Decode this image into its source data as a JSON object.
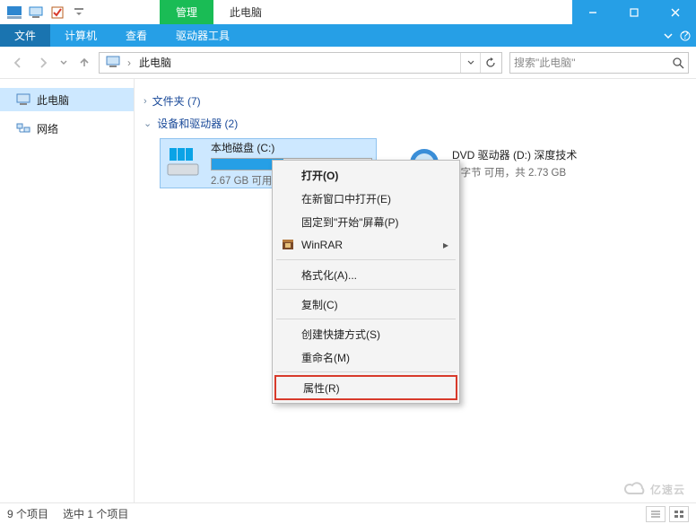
{
  "titlebar": {
    "context_tab_label": "管理",
    "title_tab_label": "此电脑"
  },
  "ribbon": {
    "file": "文件",
    "computer": "计算机",
    "view": "查看",
    "drive_tools": "驱动器工具"
  },
  "address": {
    "location": "此电脑",
    "search_placeholder": "搜索\"此电脑\""
  },
  "sidebar": {
    "this_pc": "此电脑",
    "network": "网络"
  },
  "groups": {
    "folders": "文件夹 (7)",
    "devices": "设备和驱动器 (2)"
  },
  "drives": {
    "c": {
      "name": "本地磁盘 (C:)",
      "sub": "2.67 GB 可用",
      "fill_pct": "45%"
    },
    "d": {
      "name": "DVD 驱动器 (D:) 深度技术",
      "sub": "0 字节 可用，共 2.73 GB"
    }
  },
  "context_menu": {
    "open": "打开(O)",
    "open_new_window": "在新窗口中打开(E)",
    "pin_start": "固定到\"开始\"屏幕(P)",
    "winrar": "WinRAR",
    "format": "格式化(A)...",
    "copy": "复制(C)",
    "create_shortcut": "创建快捷方式(S)",
    "rename": "重命名(M)",
    "properties": "属性(R)"
  },
  "statusbar": {
    "items": "9 个项目",
    "selected": "选中 1 个项目"
  },
  "watermark": "亿速云"
}
